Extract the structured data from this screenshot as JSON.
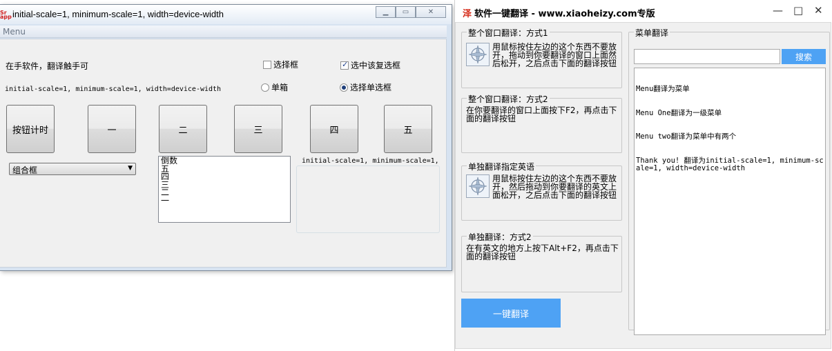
{
  "left_window": {
    "title": "initial-scale=1, minimum-scale=1, width=device-width",
    "icon_label": "Sr app",
    "menu_label": "Menu",
    "label_top": "在手软件，翻译触手可",
    "label_mono": "initial-scale=1, minimum-scale=1, width=device-width",
    "checkbox1_label": "选择框",
    "checkbox2_label": "选中该复选框",
    "checkbox2_checked": true,
    "radio1_label": "单箱",
    "radio2_label": "选择单选框",
    "radio2_checked": true,
    "buttons": [
      "按钮计时",
      "一",
      "二",
      "三",
      "四",
      "五"
    ],
    "combo_value": "组合框",
    "list_items": [
      "倒数",
      "五",
      "四",
      "三",
      "二",
      "一"
    ],
    "group_text": "initial-scale=1, minimum-scale=1,"
  },
  "right_window": {
    "logo": "泽",
    "title": "软件一键翻译 - www.xiaoheizy.com专版",
    "controls": {
      "minimize": "—",
      "maximize": "□",
      "close": "✕"
    },
    "section1": {
      "legend": "整个窗口翻译：方式1",
      "desc": "用鼠标按住左边的这个东西不要放开，拖动到你要翻译的窗口上面然后松开，之后点击下面的翻译按钮"
    },
    "section2": {
      "legend": "整个窗口翻译：方式2",
      "desc": "在你要翻译的窗口上面按下F2，再点击下面的翻译按钮"
    },
    "section3": {
      "legend": "单独翻译指定英语",
      "desc": "用鼠标按住左边的这个东西不要放开，然后拖动到你要翻译的英文上面松开，之后点击下面的翻译按钮"
    },
    "section4": {
      "legend": "单独翻译：方式2",
      "desc": "在有英文的地方上按下Alt+F2，再点击下面的翻译按钮"
    },
    "onekey_button": "一键翻译",
    "menu_panel": {
      "legend": "菜单翻译",
      "search_value": "",
      "search_button": "搜索",
      "lines": [
        "Menu翻译为菜单",
        "Menu One翻译为一级菜单",
        "Menu two翻译为菜单中有两个",
        "Thank you! 翻译为initial-scale=1, minimum-scale=1, width=device-width"
      ]
    }
  }
}
